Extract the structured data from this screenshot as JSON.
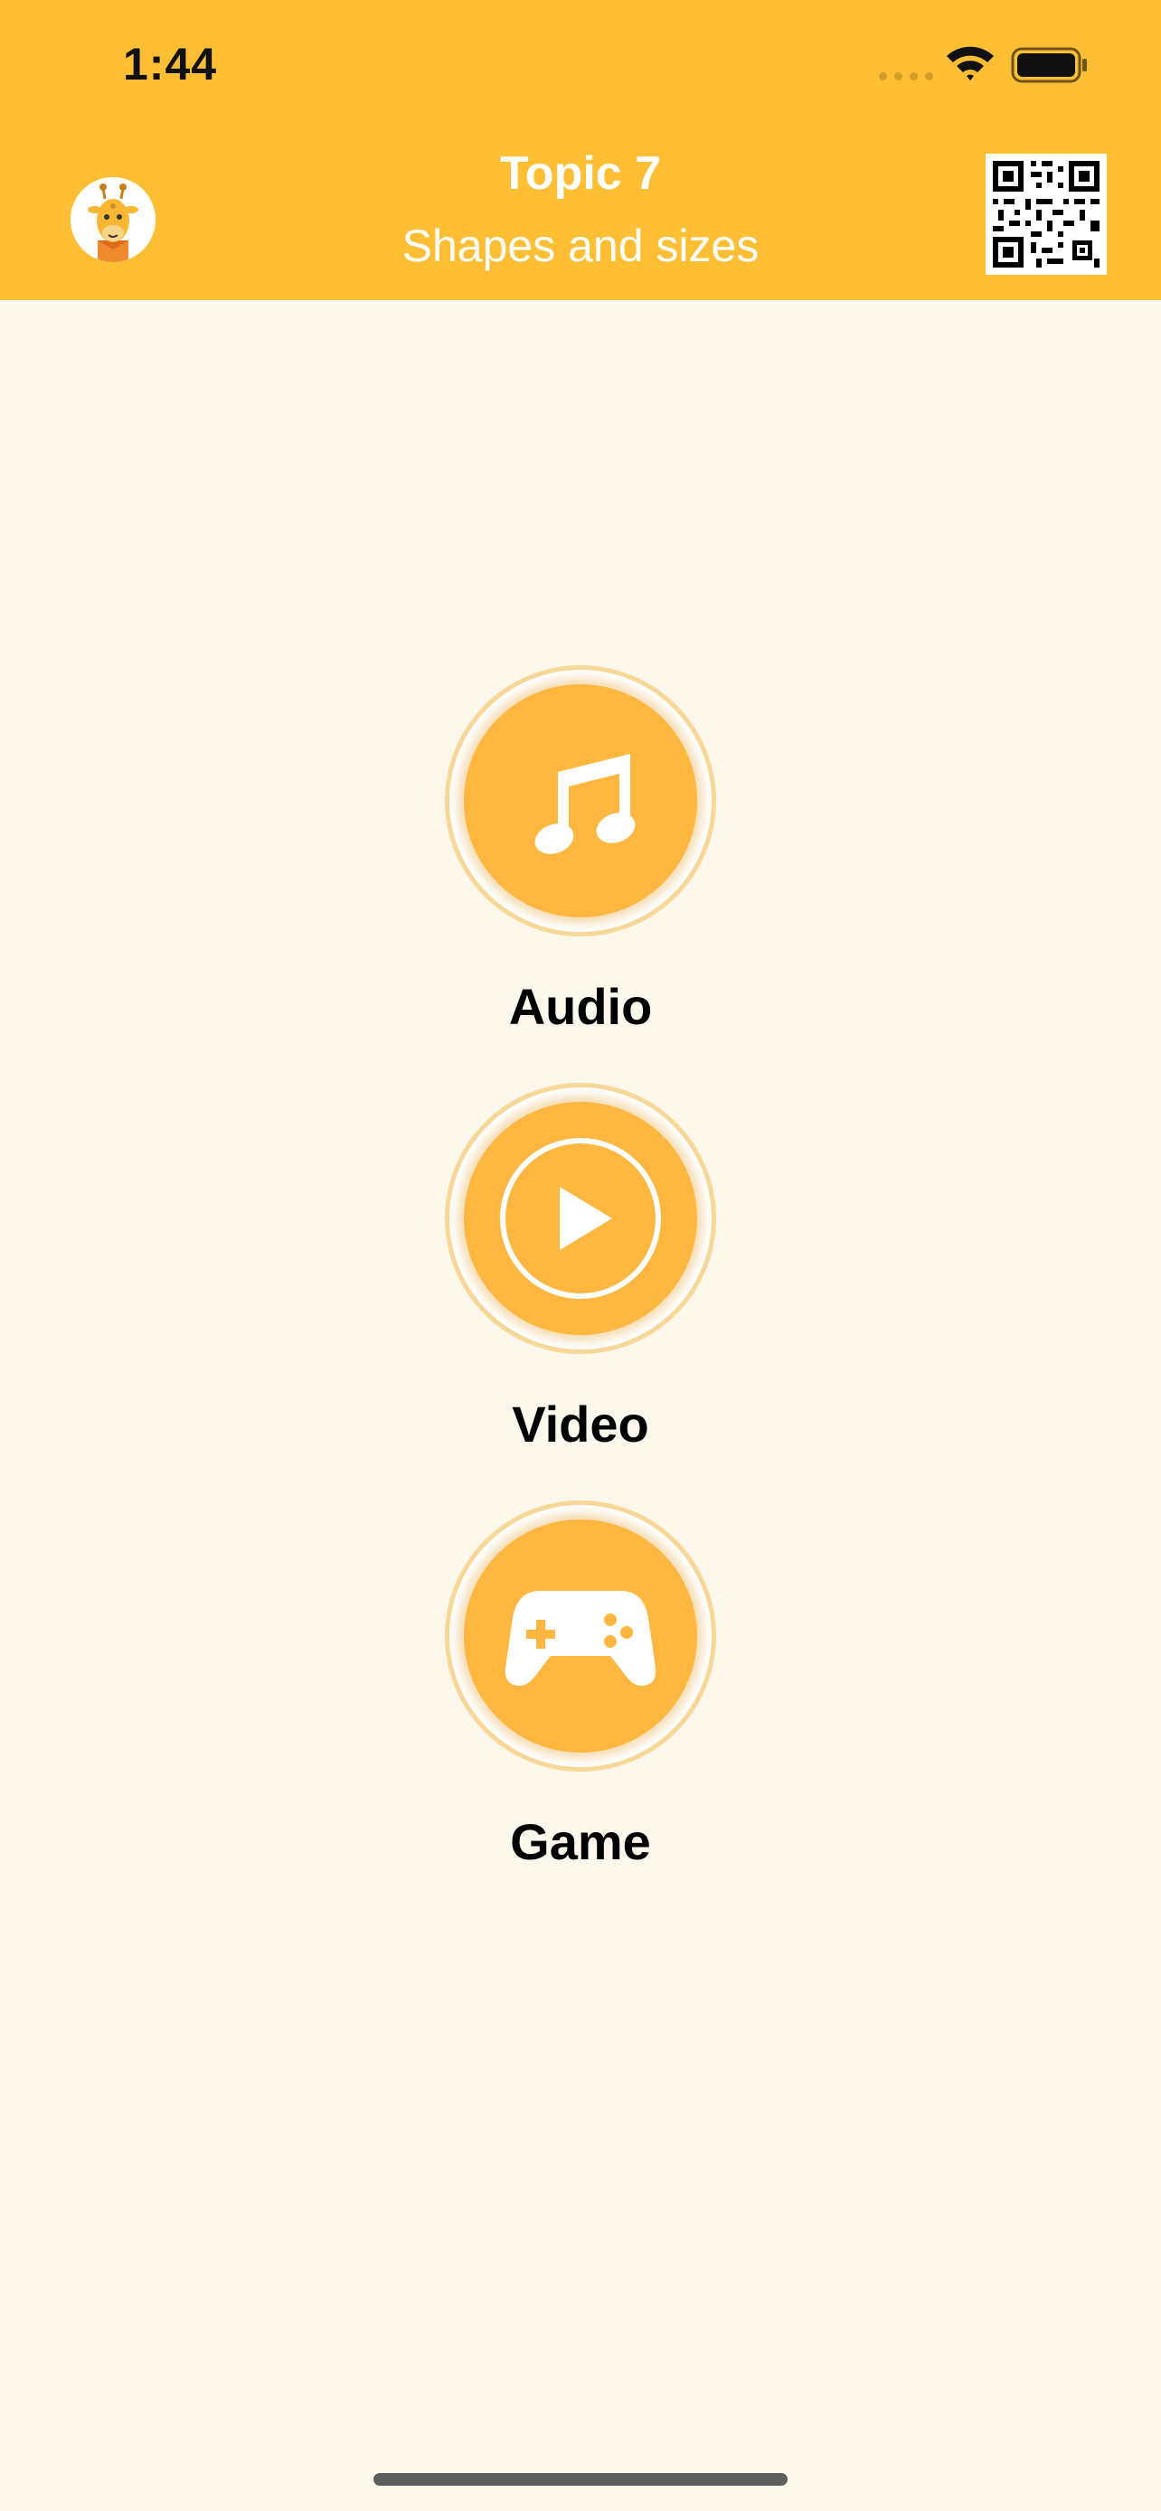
{
  "status_bar": {
    "time": "1:44"
  },
  "header": {
    "title": "Topic 7",
    "subtitle": "Shapes and sizes"
  },
  "menu": [
    {
      "label": "Audio",
      "icon": "music-note-icon"
    },
    {
      "label": "Video",
      "icon": "play-icon"
    },
    {
      "label": "Game",
      "icon": "gamepad-icon"
    }
  ],
  "colors": {
    "header_bg": "#FFBF35",
    "page_bg": "#FDF8EC",
    "button": "#FFB740",
    "button_ring": "#F9D898"
  }
}
